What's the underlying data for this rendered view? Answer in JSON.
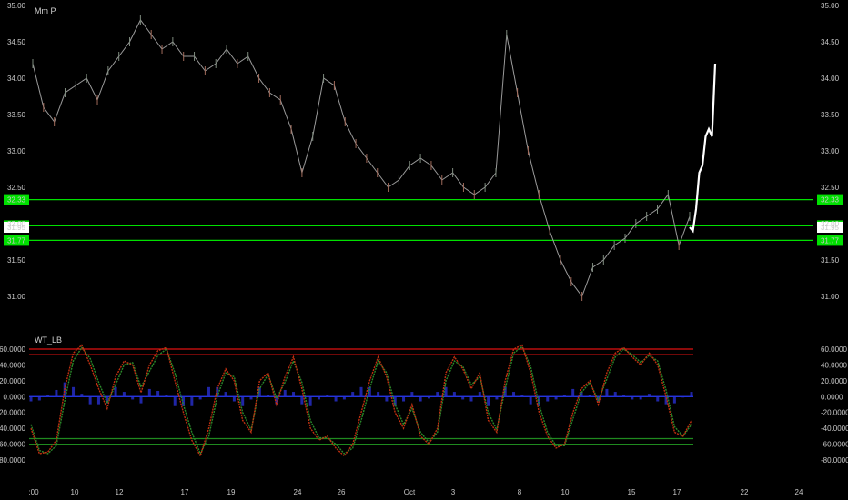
{
  "main_pane": {
    "title": "Mm P"
  },
  "oscillator_pane": {
    "title": "WT_LB"
  },
  "price_badge": "31.95",
  "level_badges": [
    "32.33",
    "31.97",
    "31.77"
  ],
  "colors": {
    "background": "#000000",
    "level_line": "#00e000",
    "badge_green": "#00e000",
    "ob_line": "#e01010",
    "os_line": "#1f8a1f",
    "zero_line": "#2a3bff",
    "wt1": "#c03010",
    "wt2": "#2a8a2a",
    "hist": "#2830d0",
    "projection": "#ffffff"
  },
  "chart_data": [
    {
      "type": "line",
      "title": "Mm P",
      "description_series": "price path",
      "y_axis_ticks": [
        "35.00",
        "34.50",
        "34.00",
        "33.50",
        "33.00",
        "32.50",
        "32.00",
        "31.50",
        "31.00"
      ],
      "ylim": [
        30.75,
        35.05
      ],
      "x_axis_ticks": [
        ":00",
        "10",
        "12",
        "17",
        "19",
        "24",
        "26",
        "Oct",
        "3",
        "8",
        "10",
        "15",
        "17",
        "22",
        "24"
      ],
      "horizontal_levels": [
        32.33,
        31.97,
        31.77
      ],
      "last_price": 31.95,
      "series": [
        {
          "values": [
            34.2,
            33.6,
            33.4,
            33.8,
            33.9,
            34.0,
            33.7,
            34.1,
            34.3,
            34.5,
            34.8,
            34.6,
            34.4,
            34.5,
            34.3,
            34.3,
            34.1,
            34.2,
            34.4,
            34.2,
            34.3,
            34.0,
            33.8,
            33.7,
            33.3,
            32.7,
            33.2,
            34.0,
            33.9,
            33.4,
            33.1,
            32.9,
            32.7,
            32.5,
            32.6,
            32.8,
            32.9,
            32.8,
            32.6,
            32.7,
            32.5,
            32.4,
            32.5,
            32.7,
            34.6,
            33.8,
            33.0,
            32.4,
            31.9,
            31.5,
            31.2,
            31.0,
            31.4,
            31.5,
            31.7,
            31.8,
            32.0,
            32.1,
            32.2,
            32.4,
            31.7,
            32.1
          ]
        },
        {
          "name": "projection",
          "values": [
            31.95,
            31.9,
            32.2,
            32.7,
            32.8,
            33.2,
            33.3,
            33.2,
            34.2
          ]
        }
      ]
    },
    {
      "type": "line",
      "title": "WT_LB",
      "y_axis_ticks": [
        "60.0000",
        "40.0000",
        "20.0000",
        "0.0000",
        "-20.0000",
        "-40.0000",
        "-60.0000",
        "-80.0000"
      ],
      "ylim": [
        -82,
        70
      ],
      "overbought_levels": [
        60,
        53
      ],
      "oversold_levels": [
        -53,
        -60
      ],
      "zero_line": 0,
      "series": [
        {
          "name": "wt1",
          "values": [
            -40,
            -72,
            -70,
            -55,
            10,
            55,
            65,
            40,
            10,
            -15,
            25,
            45,
            40,
            5,
            40,
            58,
            62,
            20,
            -20,
            -55,
            -75,
            -40,
            10,
            35,
            20,
            -30,
            -45,
            20,
            30,
            -10,
            25,
            50,
            10,
            -40,
            -55,
            -50,
            -65,
            -75,
            -60,
            -20,
            20,
            50,
            25,
            -20,
            -40,
            -10,
            -50,
            -60,
            -40,
            30,
            50,
            35,
            10,
            30,
            -30,
            -45,
            20,
            60,
            65,
            30,
            -20,
            -50,
            -65,
            -60,
            -20,
            10,
            20,
            -10,
            30,
            55,
            62,
            50,
            40,
            55,
            40,
            0,
            -45,
            -50,
            -30
          ]
        },
        {
          "name": "wt2",
          "values": [
            -35,
            -68,
            -72,
            -62,
            -5,
            45,
            62,
            48,
            18,
            -8,
            15,
            40,
            43,
            12,
            32,
            52,
            60,
            30,
            -10,
            -45,
            -72,
            -50,
            0,
            30,
            25,
            -20,
            -42,
            10,
            28,
            -2,
            18,
            45,
            18,
            -30,
            -52,
            -52,
            -60,
            -72,
            -65,
            -30,
            10,
            45,
            30,
            -10,
            -35,
            -15,
            -45,
            -58,
            -45,
            20,
            45,
            38,
            15,
            25,
            -20,
            -42,
            10,
            55,
            63,
            38,
            -10,
            -45,
            -62,
            -62,
            -28,
            5,
            18,
            -5,
            22,
            50,
            60,
            53,
            43,
            52,
            45,
            8,
            -38,
            -50,
            -35
          ]
        }
      ]
    }
  ]
}
